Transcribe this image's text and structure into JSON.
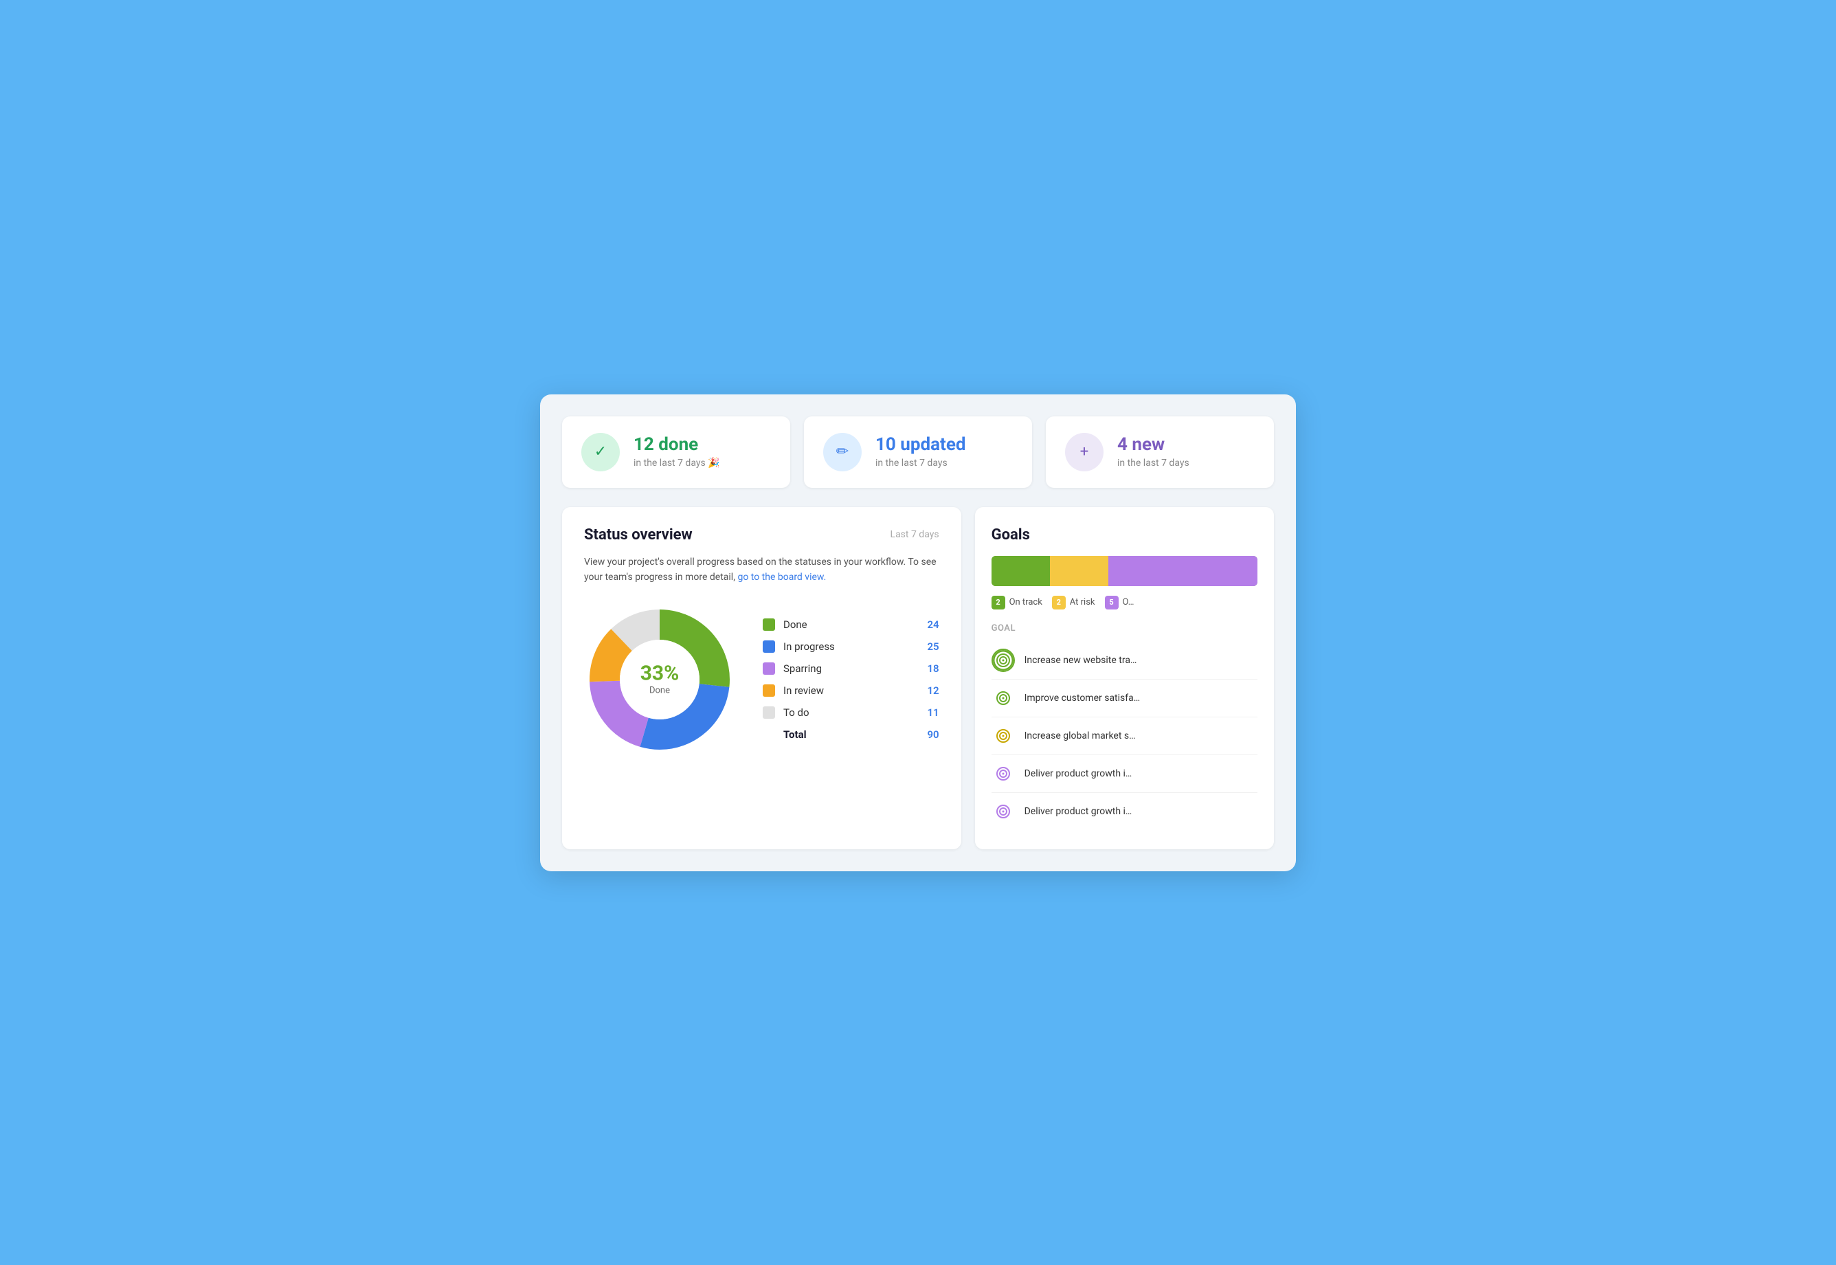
{
  "stats": [
    {
      "id": "done",
      "icon": "✓",
      "icon_class": "green",
      "main_text": "12 done",
      "main_class": "",
      "sub_text": "in the last 7 days 🎉"
    },
    {
      "id": "updated",
      "icon": "✏",
      "icon_class": "blue",
      "main_text": "10 updated",
      "main_class": "blue",
      "sub_text": "in the last 7 days"
    },
    {
      "id": "new",
      "icon": "+",
      "icon_class": "purple",
      "main_text": "4 new",
      "main_class": "purple",
      "sub_text": "in the last 7 days"
    }
  ],
  "status": {
    "title": "Status overview",
    "period": "Last 7 days",
    "description": "View your project's overall progress based on the statuses in your workflow. To see your team's progress in more detail,",
    "link_text": "go to the board view.",
    "donut": {
      "pct": "33%",
      "label": "Done",
      "segments": [
        {
          "name": "Done",
          "color": "#6aad2b",
          "value": 24,
          "pct": 26.7
        },
        {
          "name": "In progress",
          "color": "#3b7de8",
          "value": 25,
          "pct": 27.8
        },
        {
          "name": "Sparring",
          "color": "#b47de8",
          "value": 18,
          "pct": 20
        },
        {
          "name": "In review",
          "color": "#f5a623",
          "value": 12,
          "pct": 13.3
        },
        {
          "name": "To do",
          "color": "#e0e0e0",
          "value": 11,
          "pct": 12.2
        }
      ],
      "total": 90
    }
  },
  "goals": {
    "title": "Goals",
    "bar": [
      {
        "color": "#6aad2b",
        "pct": 22
      },
      {
        "color": "#f5c842",
        "pct": 22
      },
      {
        "color": "#b47de8",
        "pct": 56
      }
    ],
    "legend": [
      {
        "color": "#6aad2b",
        "count": 2,
        "label": "On track"
      },
      {
        "color": "#f5c842",
        "count": 2,
        "label": "At risk"
      },
      {
        "color": "#b47de8",
        "count": 5,
        "label": "Off track"
      }
    ],
    "items": [
      {
        "id": "goal1",
        "text": "Increase new website tra…",
        "icon_color": "#6aad2b",
        "ring": "double-green"
      },
      {
        "id": "goal2",
        "text": "Improve customer satisfa…",
        "icon_color": "#6aad2b",
        "ring": "double-green"
      },
      {
        "id": "goal3",
        "text": "Increase global market s…",
        "icon_color": "#f5c842",
        "ring": "double-yellow"
      },
      {
        "id": "goal4",
        "text": "Deliver product growth i…",
        "icon_color": "#b47de8",
        "ring": "double-purple-light"
      },
      {
        "id": "goal5",
        "text": "Deliver product growth i…",
        "icon_color": "#b47de8",
        "ring": "double-purple-light"
      }
    ]
  },
  "labels": {
    "board_link": "go to the board view.",
    "total_label": "Total",
    "goal_column": "Goal"
  }
}
